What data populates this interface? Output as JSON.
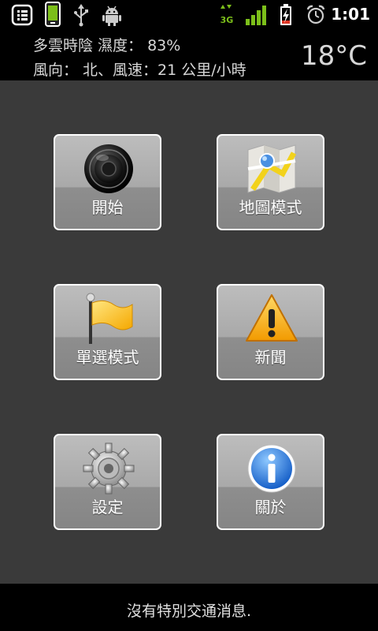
{
  "status_bar": {
    "time": "1:01",
    "network_type": "3G",
    "icons": [
      "notes-icon",
      "phone-screen-icon",
      "usb-icon",
      "android-debug-icon",
      "network-3g-icon",
      "signal-icon",
      "battery-charging-icon",
      "alarm-icon"
    ]
  },
  "weather": {
    "line1": "多雲時陰 濕度： 83%",
    "line2": "風向： 北、風速：21 公里/小時",
    "temperature": "18°C"
  },
  "menu": {
    "tiles": [
      {
        "label": "開始",
        "icon": "speaker-icon"
      },
      {
        "label": "地圖模式",
        "icon": "map-icon"
      },
      {
        "label": "單選模式",
        "icon": "flag-icon"
      },
      {
        "label": "新聞",
        "icon": "warning-icon"
      },
      {
        "label": "設定",
        "icon": "gear-icon"
      },
      {
        "label": "關於",
        "icon": "info-icon"
      }
    ]
  },
  "footer": {
    "traffic_message": "沒有特別交通消息."
  },
  "colors": {
    "background": "#3a3a3a",
    "tile": "#a9a9a9",
    "tile_border": "#ffffff",
    "bar": "#000000",
    "signal_green": "#7cbf1a"
  }
}
